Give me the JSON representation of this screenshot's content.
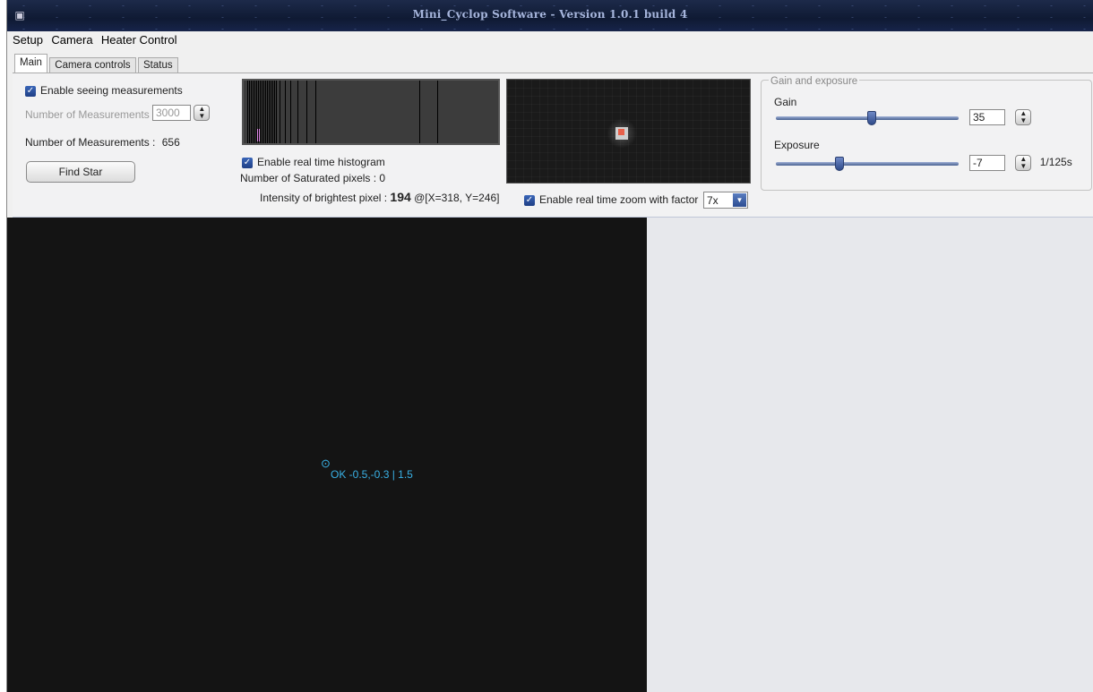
{
  "window": {
    "title": "Mini_Cyclop Software - Version 1.0.1 build 4"
  },
  "menu": [
    "Setup",
    "Camera",
    "Heater Control"
  ],
  "tabs": [
    "Main",
    "Camera controls",
    "Status"
  ],
  "main": {
    "enable_seeing_label": "Enable seeing measurements",
    "num_measurements_label": "Number of Measurements",
    "num_measurements_value": "3000",
    "num_measurements_readout_label": "Number of Measurements :",
    "num_measurements_readout_value": "656",
    "find_star_label": "Find Star",
    "enable_histogram_label": "Enable real time histogram",
    "saturated_label": "Number of Saturated pixels : 0",
    "brightest_label": "Intensity of brightest pixel :",
    "brightest_value": "194",
    "brightest_coords": "@[X=318, Y=246]",
    "enable_zoom_label": "Enable real time zoom with factor",
    "zoom_factor": "7x"
  },
  "gain_exposure": {
    "group_label": "Gain and exposure",
    "gain_label": "Gain",
    "gain_value": "35",
    "gain_level_fraction": 0.5,
    "exposure_label": "Exposure",
    "exposure_value": "-7",
    "exposure_level_fraction": 0.33,
    "exposure_time": "1/125s"
  },
  "camera_view": {
    "target_icon": "target-icon",
    "target_text": "OK -0.5,-0.3 | 1.5"
  },
  "colors": {
    "accent": "#39b1e6",
    "histogram_peak": "#e08be8",
    "star_center": "#e8604a"
  }
}
